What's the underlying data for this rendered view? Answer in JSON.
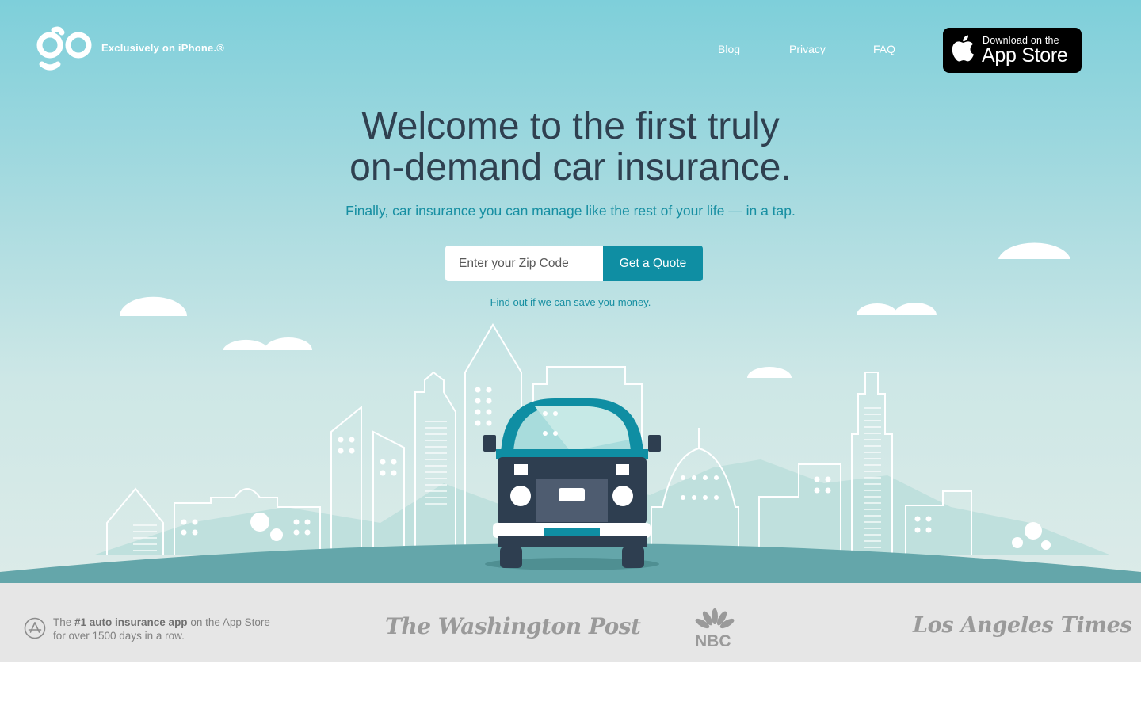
{
  "header": {
    "logo_icon": "go-logo-icon",
    "tagline": "Exclusively on iPhone.®",
    "nav": [
      {
        "label": "Blog"
      },
      {
        "label": "Privacy"
      },
      {
        "label": "FAQ"
      }
    ],
    "appstore": {
      "small": "Download on the",
      "big": "App Store",
      "icon": "apple-icon"
    }
  },
  "hero": {
    "headline_line1": "Welcome to the first truly",
    "headline_line2": "on-demand car insurance.",
    "subhead": "Finally, car insurance you can manage like the rest of your life — in a tap.",
    "zip_placeholder": "Enter your Zip Code",
    "cta_label": "Get a Quote",
    "save_text": "Find out if we can save you money.",
    "illustration_icon": "city-car-illustration"
  },
  "press": {
    "award_icon": "app-store-award-icon",
    "award_pre": "The ",
    "award_bold": "#1 auto insurance app",
    "award_post": " on the App Store",
    "award_line2": "for over 1500 days in a row.",
    "logos": [
      {
        "label": "The Washington Post"
      },
      {
        "label": "NBC"
      },
      {
        "label": "Los Angeles Times"
      }
    ]
  },
  "colors": {
    "sky_top": "#7ecfda",
    "sky_bottom": "#dcebe8",
    "accent": "#0f8ea3",
    "headline": "#2f4050",
    "ground": "#64a6aa",
    "press_bg": "#e6e6e6"
  }
}
